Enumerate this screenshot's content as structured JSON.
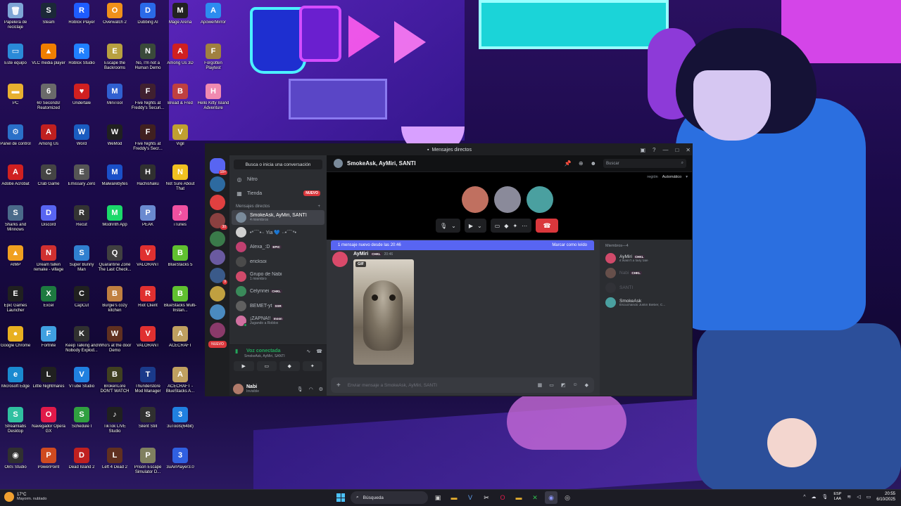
{
  "desktop": {
    "icons": [
      {
        "label": "Papelera de reciclaje",
        "color": "#7ea6d6",
        "glyph": "🗑",
        "icon": "recycle-bin-icon"
      },
      {
        "label": "Steam",
        "color": "#1b2838",
        "glyph": "S",
        "icon": "steam-icon"
      },
      {
        "label": "Roblox Player",
        "color": "#1e5cff",
        "glyph": "R",
        "icon": "roblox-icon"
      },
      {
        "label": "Overwatch 2",
        "color": "#f0901a",
        "glyph": "O",
        "icon": "overwatch-icon"
      },
      {
        "label": "Dubbing AI",
        "color": "#2a6ae8",
        "glyph": "D",
        "icon": "dubbing-ai-icon"
      },
      {
        "label": "Mage Arena",
        "color": "#222",
        "glyph": "M",
        "icon": "mage-arena-icon"
      },
      {
        "label": "ApowerMirror",
        "color": "#2c8cf0",
        "glyph": "A",
        "icon": "apowermirror-icon"
      },
      {
        "label": "Este equipo",
        "color": "#2a8ad8",
        "glyph": "▭",
        "icon": "this-pc-icon"
      },
      {
        "label": "VLC media player",
        "color": "#f07e00",
        "glyph": "▲",
        "icon": "vlc-icon"
      },
      {
        "label": "Roblox Studio",
        "color": "#2080ff",
        "glyph": "R",
        "icon": "roblox-studio-icon"
      },
      {
        "label": "Escape the Backrooms",
        "color": "#b8a040",
        "glyph": "E",
        "icon": "escape-backrooms-icon"
      },
      {
        "label": "No, I'm not a Human Demo",
        "color": "#3a4a3a",
        "glyph": "N",
        "icon": "not-human-icon"
      },
      {
        "label": "Among Us 3D",
        "color": "#d02020",
        "glyph": "A",
        "icon": "among-us-3d-icon"
      },
      {
        "label": "Forgotten Playtest",
        "color": "#a08040",
        "glyph": "F",
        "icon": "forgotten-icon"
      },
      {
        "label": "PC",
        "color": "#e8b030",
        "glyph": "▬",
        "icon": "folder-icon"
      },
      {
        "label": "60 Seconds! Reatomized",
        "color": "#6a6a6a",
        "glyph": "6",
        "icon": "sixty-seconds-icon"
      },
      {
        "label": "Undertale",
        "color": "#d02020",
        "glyph": "♥",
        "icon": "undertale-icon"
      },
      {
        "label": "MiniTool",
        "color": "#3060d0",
        "glyph": "M",
        "icon": "minitool-icon"
      },
      {
        "label": "Five Nights at Freddy's Securi...",
        "color": "#402030",
        "glyph": "F",
        "icon": "fnaf-security-icon"
      },
      {
        "label": "Bread & Fred",
        "color": "#c04040",
        "glyph": "B",
        "icon": "bread-fred-icon"
      },
      {
        "label": "Hello Kitty Island Adventure",
        "color": "#f08ab0",
        "glyph": "H",
        "icon": "hello-kitty-icon"
      },
      {
        "label": "Panel de control",
        "color": "#2a70c8",
        "glyph": "⚙",
        "icon": "control-panel-icon"
      },
      {
        "label": "Among Us",
        "color": "#c02020",
        "glyph": "A",
        "icon": "among-us-icon"
      },
      {
        "label": "Word",
        "color": "#1a5cc0",
        "glyph": "W",
        "icon": "word-icon"
      },
      {
        "label": "WeMod",
        "color": "#202020",
        "glyph": "W",
        "icon": "wemod-icon"
      },
      {
        "label": "Five Nights at Freddy's Secr...",
        "color": "#402020",
        "glyph": "F",
        "icon": "fnaf-secret-icon"
      },
      {
        "label": "Vigil",
        "color": "#c0a030",
        "glyph": "V",
        "icon": "vigil-icon"
      },
      {
        "label": "Adobe Acrobat",
        "color": "#d02020",
        "glyph": "A",
        "icon": "acrobat-icon"
      },
      {
        "label": "Crab Game",
        "color": "#444",
        "glyph": "C",
        "icon": "crab-game-icon"
      },
      {
        "label": "Emissary Zero",
        "color": "#555",
        "glyph": "E",
        "icon": "emissary-icon"
      },
      {
        "label": "Malwarebytes",
        "color": "#1a50c8",
        "glyph": "M",
        "icon": "malwarebytes-icon"
      },
      {
        "label": "Hachishaku",
        "color": "#303030",
        "glyph": "H",
        "icon": "hachishaku-icon"
      },
      {
        "label": "Not Sure About That",
        "color": "#f0c020",
        "glyph": "N",
        "icon": "not-sure-icon"
      },
      {
        "label": "Sharks and Minnows",
        "color": "#4a6a8a",
        "glyph": "S",
        "icon": "sharks-icon"
      },
      {
        "label": "Discord",
        "color": "#5865f2",
        "glyph": "D",
        "icon": "discord-icon"
      },
      {
        "label": "Recut",
        "color": "#333",
        "glyph": "R",
        "icon": "recut-icon"
      },
      {
        "label": "Modrinth App",
        "color": "#1bd96a",
        "glyph": "M",
        "icon": "modrinth-icon"
      },
      {
        "label": "PEAK",
        "color": "#6a8ad0",
        "glyph": "P",
        "icon": "peak-icon"
      },
      {
        "label": "iTunes",
        "color": "#f050a0",
        "glyph": "♪",
        "icon": "itunes-icon"
      },
      {
        "label": "AIMP",
        "color": "#f0a020",
        "glyph": "▲",
        "icon": "aimp-icon"
      },
      {
        "label": "Dream fallen remake - village",
        "color": "#d03030",
        "glyph": "N",
        "icon": "dream-fallen-icon"
      },
      {
        "label": "Super Bunny Man",
        "color": "#3080d0",
        "glyph": "S",
        "icon": "super-bunny-icon"
      },
      {
        "label": "Quarantine Zone The Last Check...",
        "color": "#404040",
        "glyph": "Q",
        "icon": "quarantine-icon"
      },
      {
        "label": "VALORANT",
        "color": "#e03030",
        "glyph": "V",
        "icon": "valorant-icon"
      },
      {
        "label": "BlueStacks 5",
        "color": "#60c030",
        "glyph": "B",
        "icon": "bluestacks-icon"
      },
      {
        "label": "Epic Games Launcher",
        "color": "#202020",
        "glyph": "E",
        "icon": "epic-icon"
      },
      {
        "label": "Excel",
        "color": "#1d7a40",
        "glyph": "X",
        "icon": "excel-icon"
      },
      {
        "label": "CapCut",
        "color": "#202020",
        "glyph": "C",
        "icon": "capcut-icon"
      },
      {
        "label": "Burgie's cozy kitchen",
        "color": "#c08040",
        "glyph": "B",
        "icon": "burgie-icon"
      },
      {
        "label": "Riot Client",
        "color": "#e03030",
        "glyph": "R",
        "icon": "riot-icon"
      },
      {
        "label": "BlueStacks Multi-Instan...",
        "color": "#60c030",
        "glyph": "B",
        "icon": "bluestacks-multi-icon"
      },
      {
        "label": "Google Chrome",
        "color": "#e8b020",
        "glyph": "●",
        "icon": "chrome-icon"
      },
      {
        "label": "Fortnite",
        "color": "#40a0e0",
        "glyph": "F",
        "icon": "fortnite-icon"
      },
      {
        "label": "Keep Talking and Nobody Explod...",
        "color": "#303030",
        "glyph": "K",
        "icon": "keep-talking-icon"
      },
      {
        "label": "Who's at the door Demo",
        "color": "#603020",
        "glyph": "W",
        "icon": "whos-at-door-icon"
      },
      {
        "label": "VALORANT",
        "color": "#e03030",
        "glyph": "V",
        "icon": "valorant2-icon"
      },
      {
        "label": "ACECRAFT",
        "color": "#c0a060",
        "glyph": "A",
        "icon": "acecraft-icon"
      },
      {
        "label": "Microsoft Edge",
        "color": "#1a8ad0",
        "glyph": "e",
        "icon": "edge-icon"
      },
      {
        "label": "Little Nightmares",
        "color": "#202020",
        "glyph": "L",
        "icon": "little-nightmares-icon"
      },
      {
        "label": "VTube Studio",
        "color": "#2080e0",
        "glyph": "V",
        "icon": "vtube-icon"
      },
      {
        "label": "BrokenLore DON'T WATCH",
        "color": "#404020",
        "glyph": "B",
        "icon": "brokenlore-icon"
      },
      {
        "label": "Thunderstore Mod Manager",
        "color": "#1a3a8a",
        "glyph": "T",
        "icon": "thunderstore-icon"
      },
      {
        "label": "ACECRAFT - BlueStacks A...",
        "color": "#c0a060",
        "glyph": "A",
        "icon": "acecraft-bs-icon"
      },
      {
        "label": "Streamlabs Desktop",
        "color": "#30c0a0",
        "glyph": "S",
        "icon": "streamlabs-icon"
      },
      {
        "label": "Navegador Opera GX",
        "color": "#e01a4a",
        "glyph": "O",
        "icon": "opera-gx-icon"
      },
      {
        "label": "Schedule I",
        "color": "#30a040",
        "glyph": "S",
        "icon": "schedule-icon"
      },
      {
        "label": "TikTok LIVE Studio",
        "color": "#202020",
        "glyph": "♪",
        "icon": "tiktok-icon"
      },
      {
        "label": "Silent Still",
        "color": "#303030",
        "glyph": "S",
        "icon": "silent-still-icon"
      },
      {
        "label": "3uTools(64bit)",
        "color": "#2080e0",
        "glyph": "3",
        "icon": "3utools-icon"
      },
      {
        "label": "OBS Studio",
        "color": "#303030",
        "glyph": "◉",
        "icon": "obs-icon"
      },
      {
        "label": "PowerPoint",
        "color": "#d04a20",
        "glyph": "P",
        "icon": "powerpoint-icon"
      },
      {
        "label": "Dead Island 2",
        "color": "#c02020",
        "glyph": "D",
        "icon": "dead-island-icon"
      },
      {
        "label": "Left 4 Dead 2",
        "color": "#603020",
        "glyph": "L",
        "icon": "l4d2-icon"
      },
      {
        "label": "Prison Escape Simulator D...",
        "color": "#808060",
        "glyph": "P",
        "icon": "prison-escape-icon"
      },
      {
        "label": "3uAirPlayer3.0",
        "color": "#3060e0",
        "glyph": "3",
        "icon": "3uairplayer-icon"
      }
    ]
  },
  "discord": {
    "window_title": "Mensajes directos",
    "rail": {
      "home_badge": "18+",
      "badges": [
        "",
        "",
        "30",
        "",
        "",
        "9",
        "",
        "",
        ""
      ],
      "new_label": "NUEVO"
    },
    "sidebar": {
      "search_label": "Busca o inicia una conversación",
      "nav": [
        {
          "label": "Nitro",
          "icon": "nitro-icon",
          "glyph": "◎",
          "badge": ""
        },
        {
          "label": "Tienda",
          "icon": "shop-icon",
          "glyph": "▦",
          "badge": "NUEVO"
        }
      ],
      "dm_header": "Mensajes directos",
      "dm_add": "+",
      "dms": [
        {
          "name": "SmokeAsk, AyMiri, SANTI",
          "sub": "4 miembros",
          "color": "#7a8a9a",
          "tag": "",
          "status": "",
          "active": true
        },
        {
          "name": "•*´¯`•·· Yia 💙 ··•´¯`*•",
          "sub": "",
          "color": "#d0d0d0",
          "tag": "",
          "status": "",
          "active": false
        },
        {
          "name": "Alexa_:D",
          "sub": "",
          "color": "#c04070",
          "tag": "EPIC",
          "status": "",
          "active": false
        },
        {
          "name": "ericksoi",
          "sub": "",
          "color": "#4a4a4a",
          "tag": "",
          "status": "",
          "active": false
        },
        {
          "name": "Grupo de Nabi",
          "sub": "1 miembro",
          "color": "#d04a6a",
          "tag": "",
          "status": "",
          "active": false
        },
        {
          "name": "Celynnei",
          "sub": "",
          "color": "#3a8a5a",
          "tag": "CHKL",
          "status": "",
          "active": false
        },
        {
          "name": "BEMET-yt",
          "sub": "",
          "color": "#606060",
          "tag": "SSR",
          "status": "",
          "active": false
        },
        {
          "name": "¡ZAPNA!!",
          "sub": "Jugando a Roblox",
          "color": "#d070a0",
          "tag": "moon",
          "status": "#23a55a",
          "active": false
        }
      ],
      "voice": {
        "title": "Voz conectada",
        "sub": "SmokeAsk, AyMiri, SANTI"
      },
      "user": {
        "name": "Nabi",
        "status": "Invisible"
      }
    },
    "header": {
      "title": "SmokeAsk, AyMiri, SANTI",
      "search_placeholder": "Buscar"
    },
    "call": {
      "region_label": "región",
      "region_value": "Automático",
      "avatars": [
        "#c07060",
        "#8a8a9a",
        "#4aa0a0"
      ]
    },
    "new_msg_bar": {
      "text": "1 mensaje nuevo desde las 20:46",
      "action": "Marcar como leído"
    },
    "message": {
      "author": "AyMiri",
      "tag": "CHKL",
      "time": "20:46",
      "gif_label": "GIF"
    },
    "composer": {
      "placeholder": "Enviar mensaje a SmokeAsk, AyMiri, SANTI"
    },
    "members": {
      "header": "Miembros—4",
      "list": [
        {
          "name": "AyMiri",
          "tag": "CHKL",
          "sub": "it wasn't a fairy tale",
          "color": "#d04a6a",
          "dim": false
        },
        {
          "name": "Nabi",
          "tag": "CHKL",
          "sub": "",
          "color": "#b07a6a",
          "dim": true
        },
        {
          "name": "SANTI",
          "tag": "",
          "sub": "",
          "color": "#3a3a40",
          "dim": true
        },
        {
          "name": "SmokeAsk",
          "tag": "",
          "sub": "Escuchando Justin Bieber, C...",
          "color": "#4aa0a0",
          "dim": false
        }
      ]
    }
  },
  "taskbar": {
    "weather_temp": "17°C",
    "weather_desc": "Mayorm. nublado",
    "search": "Búsqueda",
    "lang_top": "ESP",
    "lang_bottom": "LAA",
    "time": "20:55",
    "date": "6/10/2025"
  }
}
